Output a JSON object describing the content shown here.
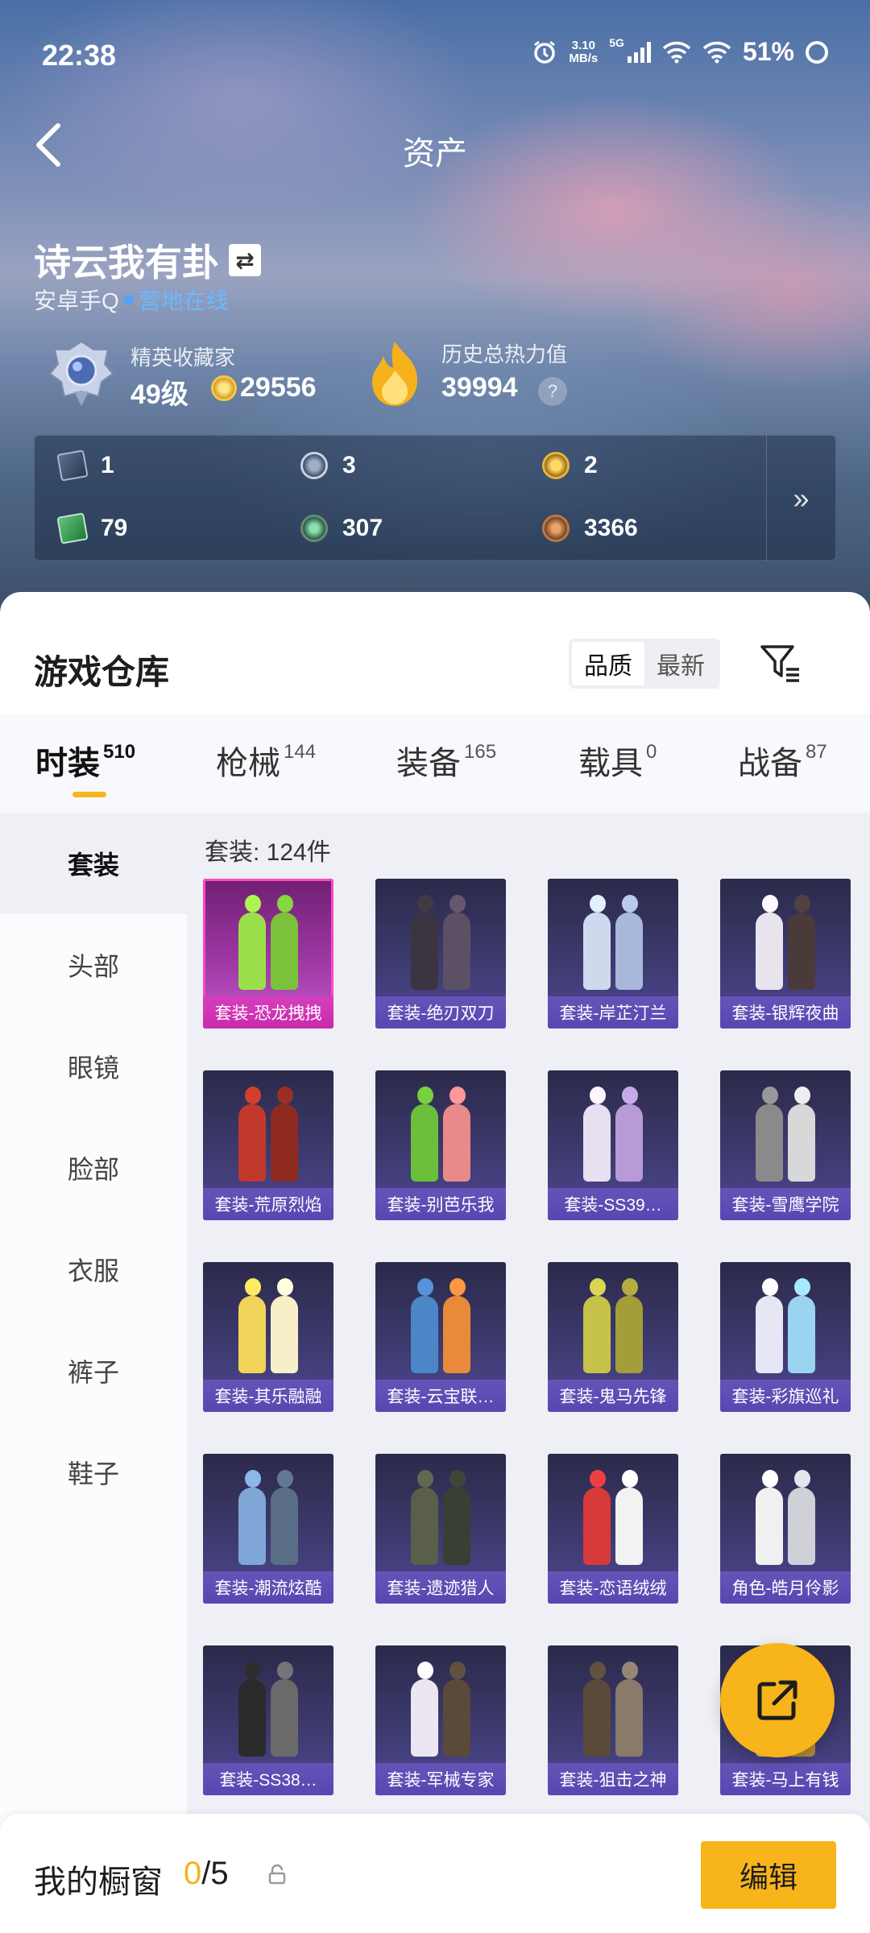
{
  "status_bar": {
    "time": "22:38",
    "net_speed_top": "3.10",
    "net_speed_bottom": "MB/s",
    "network": "5G",
    "battery": "51%"
  },
  "header": {
    "title": "资产"
  },
  "user": {
    "name": "诗云我有卦",
    "platform": "安卓手Q",
    "online_status": "营地在线",
    "collector_title": "精英收藏家",
    "collector_level": "49级",
    "collector_points": "29556",
    "heat_label": "历史总热力值",
    "heat_value": "39994",
    "help_mark": "?"
  },
  "assets": [
    {
      "icon": "card-icon",
      "value": "1"
    },
    {
      "icon": "silver-badge-icon",
      "value": "3"
    },
    {
      "icon": "gold-badge-icon",
      "value": "2"
    },
    {
      "icon": "green-ticket-icon",
      "value": "79"
    },
    {
      "icon": "green-gem-icon",
      "value": "307"
    },
    {
      "icon": "bronze-coin-icon",
      "value": "3366"
    }
  ],
  "assets_more": "»",
  "warehouse": {
    "title": "游戏仓库",
    "sort_options": [
      "品质",
      "最新"
    ],
    "tabs": [
      {
        "label": "时装",
        "count": "510"
      },
      {
        "label": "枪械",
        "count": "144"
      },
      {
        "label": "装备",
        "count": "165"
      },
      {
        "label": "载具",
        "count": "0"
      },
      {
        "label": "战备",
        "count": "87"
      }
    ],
    "categories": [
      "套装",
      "头部",
      "眼镜",
      "脸部",
      "衣服",
      "裤子",
      "鞋子"
    ],
    "count_text": "套装: 124件",
    "items": [
      "套装-恐龙拽拽",
      "套装-绝刃双刀",
      "套装-岸芷汀兰",
      "套装-银辉夜曲",
      "套装-荒原烈焰",
      "套装-别芭乐我",
      "套装-SS39…",
      "套装-雪鹰学院",
      "套装-其乐融融",
      "套装-云宝联…",
      "套装-鬼马先锋",
      "套装-彩旗巡礼",
      "套装-潮流炫酷",
      "套装-遗迹猎人",
      "套装-恋语绒绒",
      "角色-皓月伶影",
      "套装-SS38…",
      "套装-军械专家",
      "套装-狙击之神",
      "套装-马上有钱"
    ]
  },
  "showcase": {
    "title": "我的橱窗",
    "current": "0",
    "total": "/5",
    "edit_label": "编辑"
  },
  "colors": {
    "accent": "#f8b41b",
    "online": "#4fa3ff",
    "highlight": "#ff47c5"
  }
}
